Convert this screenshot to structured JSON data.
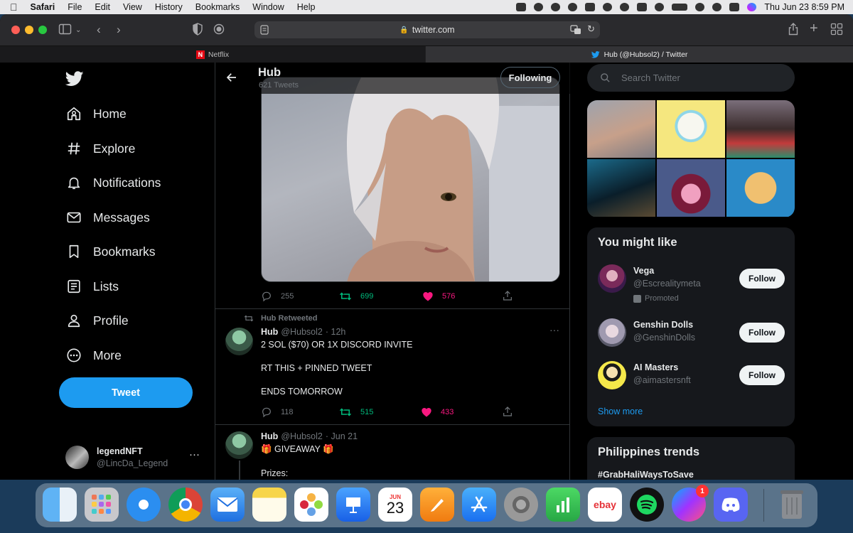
{
  "menubar": {
    "app": "Safari",
    "items": [
      "File",
      "Edit",
      "View",
      "History",
      "Bookmarks",
      "Window",
      "Help"
    ],
    "datetime": "Thu Jun 23  8:59 PM"
  },
  "browser": {
    "url": "twitter.com",
    "tabs": [
      {
        "title": "Netflix"
      },
      {
        "title": "Hub (@Hubsol2) / Twitter"
      }
    ]
  },
  "nav": {
    "items": [
      {
        "label": "Home",
        "icon": "home-icon"
      },
      {
        "label": "Explore",
        "icon": "hashtag-icon"
      },
      {
        "label": "Notifications",
        "icon": "bell-icon"
      },
      {
        "label": "Messages",
        "icon": "mail-icon"
      },
      {
        "label": "Bookmarks",
        "icon": "bookmark-icon"
      },
      {
        "label": "Lists",
        "icon": "list-icon"
      },
      {
        "label": "Profile",
        "icon": "person-icon"
      },
      {
        "label": "More",
        "icon": "more-circle-icon"
      }
    ],
    "tweet_button": "Tweet",
    "account": {
      "name": "legendNFT",
      "handle": "@LincDa_Legend",
      "more": "···"
    }
  },
  "profile_header": {
    "name": "Hub",
    "tweet_count": "621 Tweets",
    "following_button": "Following"
  },
  "tweets": [
    {
      "stats": {
        "replies": "255",
        "retweets": "699",
        "likes": "576"
      }
    },
    {
      "retweeted_by": "Hub Retweeted",
      "name": "Hub",
      "handle": "@Hubsol2",
      "time": "· 12h",
      "lines": [
        "2 SOL ($70) OR 1X DISCORD INVITE",
        "RT THIS + PINNED TWEET",
        "ENDS TOMORROW"
      ],
      "stats": {
        "replies": "118",
        "retweets": "515",
        "likes": "433"
      }
    },
    {
      "name": "Hub",
      "handle": "@Hubsol2",
      "time": "· Jun 21",
      "lines": [
        "🎁 GIVEAWAY 🎁",
        "Prizes:"
      ]
    }
  ],
  "search": {
    "placeholder": "Search Twitter"
  },
  "suggestions": {
    "title": "You might like",
    "users": [
      {
        "name": "Vega",
        "handle": "@Escrealitymeta",
        "promoted": "Promoted",
        "button": "Follow"
      },
      {
        "name": "Genshin Dolls",
        "handle": "@GenshinDolls",
        "button": "Follow"
      },
      {
        "name": "AI Masters",
        "handle": "@aimastersnft",
        "button": "Follow"
      }
    ],
    "show_more": "Show more"
  },
  "trends": {
    "title": "Philippines trends",
    "first": "#GrabHaliWaysToSave"
  },
  "dock": {
    "calendar_month": "JUN",
    "calendar_day": "23",
    "ebay_label": "ebay",
    "messenger_badge": "1"
  },
  "colors": {
    "accent": "#1d9bf0",
    "retweet": "#00ba7c",
    "like": "#f91880",
    "background": "#000000"
  }
}
